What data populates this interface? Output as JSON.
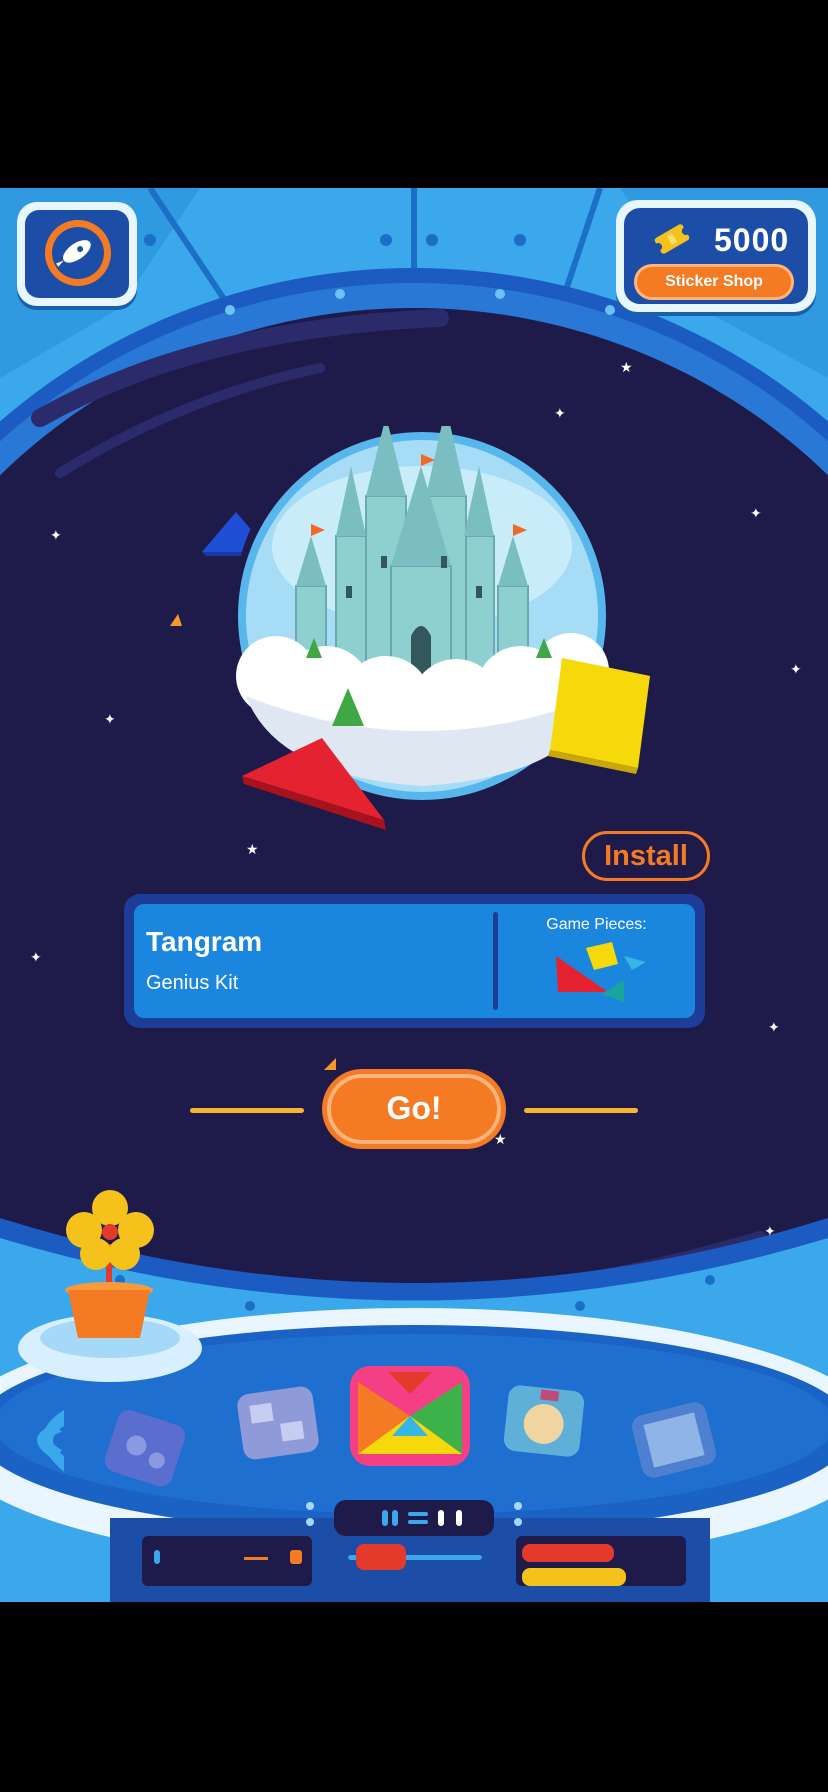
{
  "header": {
    "profile_icon": "rocket-icon",
    "coins": "5000",
    "coin_icon": "ticket-icon",
    "shop_label": "Sticker Shop"
  },
  "game": {
    "install_label": "Install",
    "title": "Tangram",
    "subtitle": "Genius Kit",
    "pieces_label": "Game Pieces:",
    "play_label": "Go!"
  },
  "dock": {
    "items": [
      "numbers-game",
      "words-game",
      "tangram-game",
      "pizza-game",
      "masterpiece-game"
    ],
    "selected": "tangram-game"
  },
  "colors": {
    "space": "#1e1b4b",
    "frame": "#33a3e6",
    "accent": "#f47a23",
    "card": "#1a86de"
  }
}
